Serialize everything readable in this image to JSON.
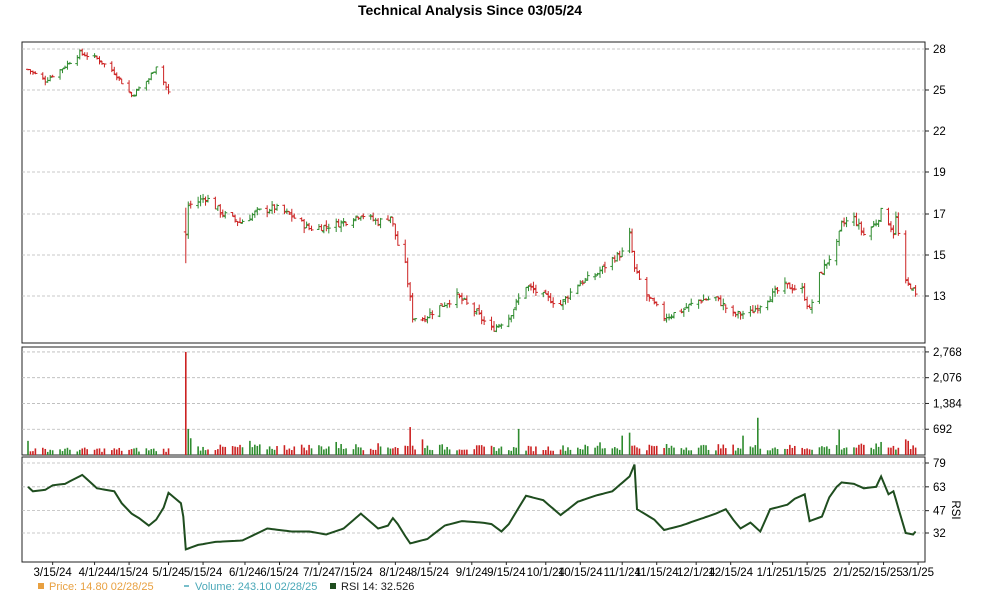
{
  "chart_data": {
    "title": "Technical Analysis Since 03/05/24",
    "x_tick_labels": [
      "3/15/24",
      "4/1/24",
      "4/15/24",
      "5/1/24",
      "5/15/24",
      "6/1/24",
      "6/15/24",
      "7/1/24",
      "7/15/24",
      "8/1/24",
      "8/15/24",
      "9/1/24",
      "9/15/24",
      "10/1/24",
      "10/15/24",
      "11/1/24",
      "11/15/24",
      "12/1/24",
      "12/15/24",
      "1/1/25",
      "1/15/25",
      "2/1/25",
      "2/15/25",
      "3/1/25"
    ],
    "panels": [
      {
        "name": "price",
        "type": "ohlc",
        "y_ticks": [
          13,
          15,
          17,
          19,
          22,
          25,
          28
        ],
        "grid": true,
        "colors": {
          "up": "#2e8b2e",
          "down": "#cc2222"
        },
        "close_path": [
          [
            "2024-03-05",
            26.5
          ],
          [
            "2024-03-12",
            25.7
          ],
          [
            "2024-03-19",
            26.6
          ],
          [
            "2024-03-26",
            27.7
          ],
          [
            "2024-04-02",
            27.3
          ],
          [
            "2024-04-09",
            26.3
          ],
          [
            "2024-04-16",
            24.6
          ],
          [
            "2024-04-23",
            25.8
          ],
          [
            "2024-04-26",
            26.8
          ],
          [
            "2024-05-01",
            24.8
          ],
          [
            "2024-05-08",
            16.0
          ],
          [
            "2024-05-09",
            17.4
          ],
          [
            "2024-05-13",
            17.6
          ],
          [
            "2024-05-16",
            17.8
          ],
          [
            "2024-05-23",
            17.0
          ],
          [
            "2024-05-30",
            16.6
          ],
          [
            "2024-06-06",
            17.1
          ],
          [
            "2024-06-13",
            17.3
          ],
          [
            "2024-06-20",
            16.9
          ],
          [
            "2024-06-27",
            16.3
          ],
          [
            "2024-07-04",
            16.4
          ],
          [
            "2024-07-11",
            16.6
          ],
          [
            "2024-07-18",
            17.0
          ],
          [
            "2024-07-25",
            16.6
          ],
          [
            "2024-07-30",
            16.9
          ],
          [
            "2024-08-02",
            15.5
          ],
          [
            "2024-08-05",
            14.5
          ],
          [
            "2024-08-08",
            12.0
          ],
          [
            "2024-08-12",
            11.9
          ],
          [
            "2024-08-19",
            12.5
          ],
          [
            "2024-08-26",
            13.0
          ],
          [
            "2024-09-02",
            12.3
          ],
          [
            "2024-09-09",
            11.4
          ],
          [
            "2024-09-16",
            12.0
          ],
          [
            "2024-09-23",
            13.5
          ],
          [
            "2024-09-30",
            13.0
          ],
          [
            "2024-10-07",
            12.6
          ],
          [
            "2024-10-14",
            13.6
          ],
          [
            "2024-10-21",
            14.0
          ],
          [
            "2024-10-28",
            14.8
          ],
          [
            "2024-11-01",
            15.1
          ],
          [
            "2024-11-04",
            16.0
          ],
          [
            "2024-11-06",
            14.3
          ],
          [
            "2024-11-11",
            13.0
          ],
          [
            "2024-11-18",
            12.0
          ],
          [
            "2024-11-25",
            12.3
          ],
          [
            "2024-12-02",
            12.8
          ],
          [
            "2024-12-09",
            12.9
          ],
          [
            "2024-12-16",
            12.1
          ],
          [
            "2024-12-23",
            12.2
          ],
          [
            "2024-12-30",
            12.9
          ],
          [
            "2025-01-06",
            13.5
          ],
          [
            "2025-01-13",
            13.3
          ],
          [
            "2025-01-16",
            12.3
          ],
          [
            "2025-01-20",
            14.0
          ],
          [
            "2025-01-27",
            15.5
          ],
          [
            "2025-01-29",
            16.5
          ],
          [
            "2025-02-03",
            16.8
          ],
          [
            "2025-02-07",
            16.0
          ],
          [
            "2025-02-12",
            16.6
          ],
          [
            "2025-02-14",
            17.1
          ],
          [
            "2025-02-17",
            16.6
          ],
          [
            "2025-02-19",
            16.1
          ],
          [
            "2025-02-20",
            16.8
          ],
          [
            "2025-02-24",
            13.6
          ],
          [
            "2025-02-26",
            13.5
          ],
          [
            "2025-02-28",
            13.0
          ]
        ]
      },
      {
        "name": "volume",
        "type": "bar",
        "y_ticks": [
          692,
          1384,
          2076,
          2768
        ],
        "grid": true,
        "baseline_path": [
          [
            "2024-03-05",
            150
          ],
          [
            "2024-05-01",
            150
          ],
          [
            "2024-05-07",
            200
          ],
          [
            "2024-08-01",
            240
          ],
          [
            "2024-09-20",
            180
          ],
          [
            "2024-11-01",
            230
          ],
          [
            "2025-01-01",
            210
          ],
          [
            "2025-03-03",
            240
          ]
        ],
        "spikes": [
          [
            "2024-03-05",
            380
          ],
          [
            "2024-05-08",
            2768
          ],
          [
            "2024-05-09",
            700
          ],
          [
            "2024-05-10",
            450
          ],
          [
            "2024-06-03",
            380
          ],
          [
            "2024-07-08",
            350
          ],
          [
            "2024-08-07",
            750
          ],
          [
            "2024-08-12",
            420
          ],
          [
            "2024-09-20",
            700
          ],
          [
            "2024-10-23",
            340
          ],
          [
            "2024-11-01",
            520
          ],
          [
            "2024-11-04",
            600
          ],
          [
            "2024-12-20",
            520
          ],
          [
            "2024-12-26",
            1000
          ],
          [
            "2025-01-28",
            680
          ],
          [
            "2025-02-14",
            350
          ],
          [
            "2025-02-24",
            420
          ],
          [
            "2025-02-25",
            380
          ]
        ]
      },
      {
        "name": "rsi",
        "type": "line",
        "axis_label": "RSI",
        "y_ticks": [
          32,
          47,
          63,
          79
        ],
        "grid": true,
        "color": "#1f4d1f",
        "path": [
          [
            "2024-03-05",
            63
          ],
          [
            "2024-03-07",
            60
          ],
          [
            "2024-03-12",
            61
          ],
          [
            "2024-03-15",
            64
          ],
          [
            "2024-03-20",
            65
          ],
          [
            "2024-03-27",
            71
          ],
          [
            "2024-04-02",
            62
          ],
          [
            "2024-04-09",
            60
          ],
          [
            "2024-04-12",
            52
          ],
          [
            "2024-04-16",
            45
          ],
          [
            "2024-04-19",
            42
          ],
          [
            "2024-04-23",
            37
          ],
          [
            "2024-04-26",
            41
          ],
          [
            "2024-04-29",
            49
          ],
          [
            "2024-05-01",
            59
          ],
          [
            "2024-05-06",
            52
          ],
          [
            "2024-05-07",
            43
          ],
          [
            "2024-05-08",
            21
          ],
          [
            "2024-05-13",
            24
          ],
          [
            "2024-05-20",
            26
          ],
          [
            "2024-05-31",
            27
          ],
          [
            "2024-06-10",
            35
          ],
          [
            "2024-06-20",
            33
          ],
          [
            "2024-06-27",
            33
          ],
          [
            "2024-07-04",
            31
          ],
          [
            "2024-07-11",
            35
          ],
          [
            "2024-07-18",
            45
          ],
          [
            "2024-07-25",
            35
          ],
          [
            "2024-07-29",
            37
          ],
          [
            "2024-07-31",
            42
          ],
          [
            "2024-08-02",
            38
          ],
          [
            "2024-08-05",
            30
          ],
          [
            "2024-08-07",
            25
          ],
          [
            "2024-08-14",
            28
          ],
          [
            "2024-08-21",
            37
          ],
          [
            "2024-08-28",
            40
          ],
          [
            "2024-09-05",
            39
          ],
          [
            "2024-09-09",
            38
          ],
          [
            "2024-09-13",
            33
          ],
          [
            "2024-09-16",
            38
          ],
          [
            "2024-09-23",
            57
          ],
          [
            "2024-09-30",
            54
          ],
          [
            "2024-10-07",
            44
          ],
          [
            "2024-10-14",
            53
          ],
          [
            "2024-10-21",
            57
          ],
          [
            "2024-10-28",
            60
          ],
          [
            "2024-11-04",
            70
          ],
          [
            "2024-11-06",
            78
          ],
          [
            "2024-11-07",
            48
          ],
          [
            "2024-11-14",
            41
          ],
          [
            "2024-11-18",
            34
          ],
          [
            "2024-11-25",
            37
          ],
          [
            "2024-12-02",
            41
          ],
          [
            "2024-12-09",
            45
          ],
          [
            "2024-12-13",
            48
          ],
          [
            "2024-12-16",
            41
          ],
          [
            "2024-12-19",
            35
          ],
          [
            "2024-12-23",
            39
          ],
          [
            "2024-12-27",
            33
          ],
          [
            "2024-12-31",
            48
          ],
          [
            "2025-01-07",
            51
          ],
          [
            "2025-01-10",
            55
          ],
          [
            "2025-01-14",
            58
          ],
          [
            "2025-01-16",
            40
          ],
          [
            "2025-01-21",
            43
          ],
          [
            "2025-01-24",
            56
          ],
          [
            "2025-01-27",
            63
          ],
          [
            "2025-01-29",
            66
          ],
          [
            "2025-02-03",
            65
          ],
          [
            "2025-02-07",
            62
          ],
          [
            "2025-02-12",
            63
          ],
          [
            "2025-02-14",
            70
          ],
          [
            "2025-02-17",
            58
          ],
          [
            "2025-02-19",
            60
          ],
          [
            "2025-02-24",
            32
          ],
          [
            "2025-02-27",
            31
          ],
          [
            "2025-02-28",
            33
          ]
        ]
      }
    ],
    "legend": [
      {
        "label": "Price: 14.80  02/28/25",
        "color": "#e8a040",
        "marker": "square"
      },
      {
        "label": "Volume: 243.10  02/28/25",
        "color": "#4aa8b8",
        "marker": "dash"
      },
      {
        "label": "RSI 14: 32.526",
        "color": "#1f4d1f",
        "marker": "line"
      }
    ]
  }
}
